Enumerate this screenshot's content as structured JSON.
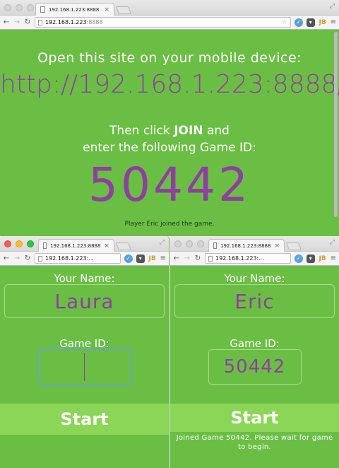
{
  "colors": {
    "page_bg": "#6bbe44",
    "accent_purple": "#8e3fa0",
    "button_bg": "#8bd656"
  },
  "windows": {
    "top": {
      "tab_title": "192.168.1.223:8888",
      "address_host": "192.168.1.223",
      "address_port": ":8888",
      "page": {
        "instruction": "Open this site on your mobile device:",
        "url": "http://192.168.1.223:8888/",
        "then_prefix": "Then click",
        "then_bold": "JOIN",
        "then_suffix": "and",
        "then_line2": "enter the following Game ID:",
        "game_id": "50442",
        "status": "Player Eric joined the game."
      }
    },
    "left": {
      "tab_title": "192.168.1.223:8888",
      "address_text": "192.168.1.223:...",
      "page": {
        "name_label": "Your Name:",
        "name_value": "Laura",
        "game_id_label": "Game ID:",
        "game_id_value": "",
        "start_label": "Start"
      }
    },
    "right": {
      "tab_title": "192.168.1.223:8888",
      "address_text": "192.168.1.223:...",
      "page": {
        "name_label": "Your Name:",
        "name_value": "Eric",
        "game_id_label": "Game ID:",
        "game_id_value": "50442",
        "start_label": "Start",
        "message": "Joined Game 50442. Please wait for game to begin."
      }
    }
  },
  "toolbar": {
    "ext_jb": "JB"
  }
}
